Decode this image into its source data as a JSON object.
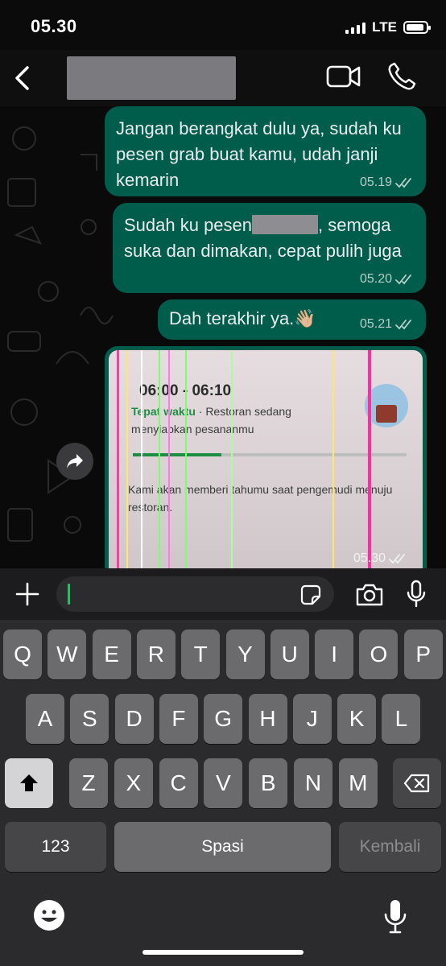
{
  "status_bar": {
    "time": "05.30",
    "network": "LTE",
    "battery_level": 0.9
  },
  "header": {
    "back_icon": "chevron-left-icon",
    "contact_name_redacted": true,
    "video_icon": "video-camera-icon",
    "call_icon": "phone-icon"
  },
  "messages": [
    {
      "text": "Jangan berangkat dulu ya, sudah ku pesen grab buat kamu, udah janji kemarin",
      "time": "05.19",
      "status": "read"
    },
    {
      "text_before": "Sudah ku pesen",
      "text_after": ", semoga suka dan dimakan, cepat pulih juga",
      "time": "05.20",
      "status": "read"
    },
    {
      "text": "Dah terakhir ya.👋🏼",
      "time": "05.21",
      "status": "read"
    }
  ],
  "image_message": {
    "time": "05.30",
    "status": "read",
    "photo": {
      "eta": "06:00 - 06:10",
      "on_time_label": "Tepat waktu",
      "on_time_detail": " · Restoran sedang",
      "preparing": "menyiapkan pesananmu",
      "notify": "Kami akan memberi tahumu saat pengemudi menuju restoran."
    }
  },
  "forward_icon": "forward-arrow-icon",
  "input_bar": {
    "plus_icon": "plus-icon",
    "message_value": "",
    "sticker_icon": "sticker-icon",
    "camera_icon": "camera-icon",
    "mic_icon": "microphone-icon"
  },
  "keyboard": {
    "row1": [
      "Q",
      "W",
      "E",
      "R",
      "T",
      "Y",
      "U",
      "I",
      "O",
      "P"
    ],
    "row2": [
      "A",
      "S",
      "D",
      "F",
      "G",
      "H",
      "J",
      "K",
      "L"
    ],
    "row3": [
      "Z",
      "X",
      "C",
      "V",
      "B",
      "N",
      "M"
    ],
    "numbers_label": "123",
    "space_label": "Spasi",
    "return_label": "Kembali",
    "emoji_icon": "emoji-icon",
    "dictation_icon": "microphone-icon"
  },
  "colors": {
    "bubble": "#005c4b",
    "accent": "#21c063",
    "keyboard_bg": "#2b2b2d"
  }
}
